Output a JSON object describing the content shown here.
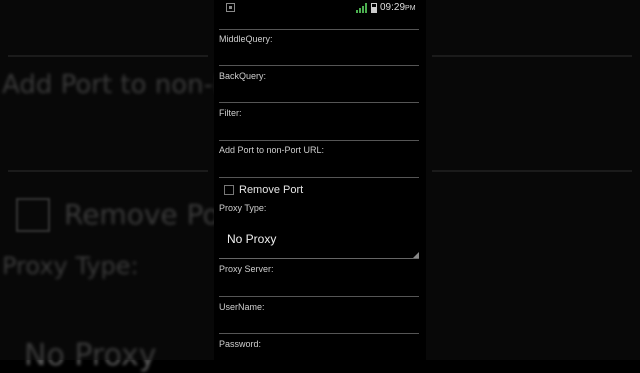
{
  "status_bar": {
    "time": "09:29",
    "ampm": "PM"
  },
  "fields": [
    {
      "label": "MiddleQuery:",
      "value": ""
    },
    {
      "label": "BackQuery:",
      "value": ""
    },
    {
      "label": "Filter:",
      "value": ""
    },
    {
      "label": "Add Port to non-Port URL:",
      "value": ""
    }
  ],
  "remove_port": {
    "label": "Remove Port",
    "checked": false
  },
  "proxy_type": {
    "label": "Proxy Type:",
    "selected": "No Proxy"
  },
  "fields2": [
    {
      "label": "Proxy Server:",
      "value": ""
    },
    {
      "label": "UserName:",
      "value": ""
    },
    {
      "label": "Password:",
      "value": ""
    }
  ],
  "background": {
    "add_port_text": "Add Port to non-P",
    "remove_port_text": "Remove Po",
    "proxy_type_text": "Proxy Type:",
    "no_proxy_text": "No Proxy"
  }
}
